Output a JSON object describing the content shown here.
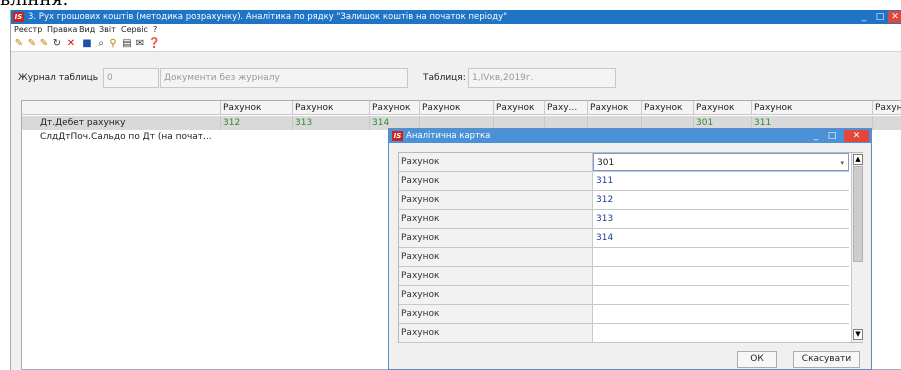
{
  "cut_off_text": "вління.",
  "main_window": {
    "title": "3. Рух грошових коштів (методика розрахунку). Аналітика по рядку \"Залишок коштів на початок періоду\"",
    "logo": "IS",
    "controls": {
      "minimize": "_",
      "maximize": "□",
      "close": "✕"
    }
  },
  "menu": [
    "Реєстр",
    "Правка",
    "Вид",
    "Звіт",
    "Сервіс",
    "?"
  ],
  "toolbar_icons": [
    {
      "name": "new-icon",
      "glyph": "✎",
      "color": "#c27a00"
    },
    {
      "name": "copy-icon",
      "glyph": "✎",
      "color": "#c27a00"
    },
    {
      "name": "edit-icon",
      "glyph": "✎",
      "color": "#c27a00"
    },
    {
      "name": "refresh-icon",
      "glyph": "↻",
      "color": "#333333"
    },
    {
      "name": "delete-icon",
      "glyph": "✕",
      "color": "#d01010"
    },
    {
      "name": "save-icon",
      "glyph": "■",
      "color": "#1f4fa8"
    },
    {
      "name": "search-icon",
      "glyph": "⌕",
      "color": "#333333"
    },
    {
      "name": "filter-icon",
      "glyph": "⚲",
      "color": "#c27a00"
    },
    {
      "name": "form-icon",
      "glyph": "▤",
      "color": "#333333"
    },
    {
      "name": "mail-icon",
      "glyph": "✉",
      "color": "#333333"
    },
    {
      "name": "help-icon",
      "glyph": "❓",
      "color": "#222222"
    }
  ],
  "filters": {
    "journal_label": "Журнал таблиць",
    "journal_code": "0",
    "journal_name": "Документи без журналу",
    "table_label": "Таблиця:",
    "table_value": "1,IVкв,2019г."
  },
  "grid": {
    "columns": [
      "Рахунок",
      "Рахунок",
      "Рахунок",
      "Рахунок",
      "Рахунок",
      "Раху...",
      "Рахунок",
      "Рахунок",
      "Рахунок",
      "Рахунок",
      "Рахуно"
    ],
    "rows": [
      {
        "label": "Дт.Дебет рахунку",
        "values": [
          "312",
          "313",
          "314",
          "",
          "",
          "",
          "",
          "",
          "301",
          "311",
          ""
        ]
      },
      {
        "label": "СлдДтПоч.Сальдо по Дт (на почат...",
        "values": []
      }
    ]
  },
  "dialog": {
    "title": "Аналітична картка",
    "logo": "IS",
    "controls": {
      "minimize": "_",
      "maximize": "□",
      "close": "✕"
    },
    "rows": [
      {
        "key": "Рахунок",
        "value": "301"
      },
      {
        "key": "Рахунок",
        "value": "311"
      },
      {
        "key": "Рахунок",
        "value": "312"
      },
      {
        "key": "Рахунок",
        "value": "313"
      },
      {
        "key": "Рахунок",
        "value": "314"
      },
      {
        "key": "Рахунок",
        "value": ""
      },
      {
        "key": "Рахунок",
        "value": ""
      },
      {
        "key": "Рахунок",
        "value": ""
      },
      {
        "key": "Рахунок",
        "value": ""
      },
      {
        "key": "Рахунок",
        "value": ""
      }
    ],
    "dropdown_arrow": "▾",
    "scroll_up": "▲",
    "scroll_down": "▼",
    "ok_label": "ОК",
    "cancel_label": "Скасувати"
  }
}
